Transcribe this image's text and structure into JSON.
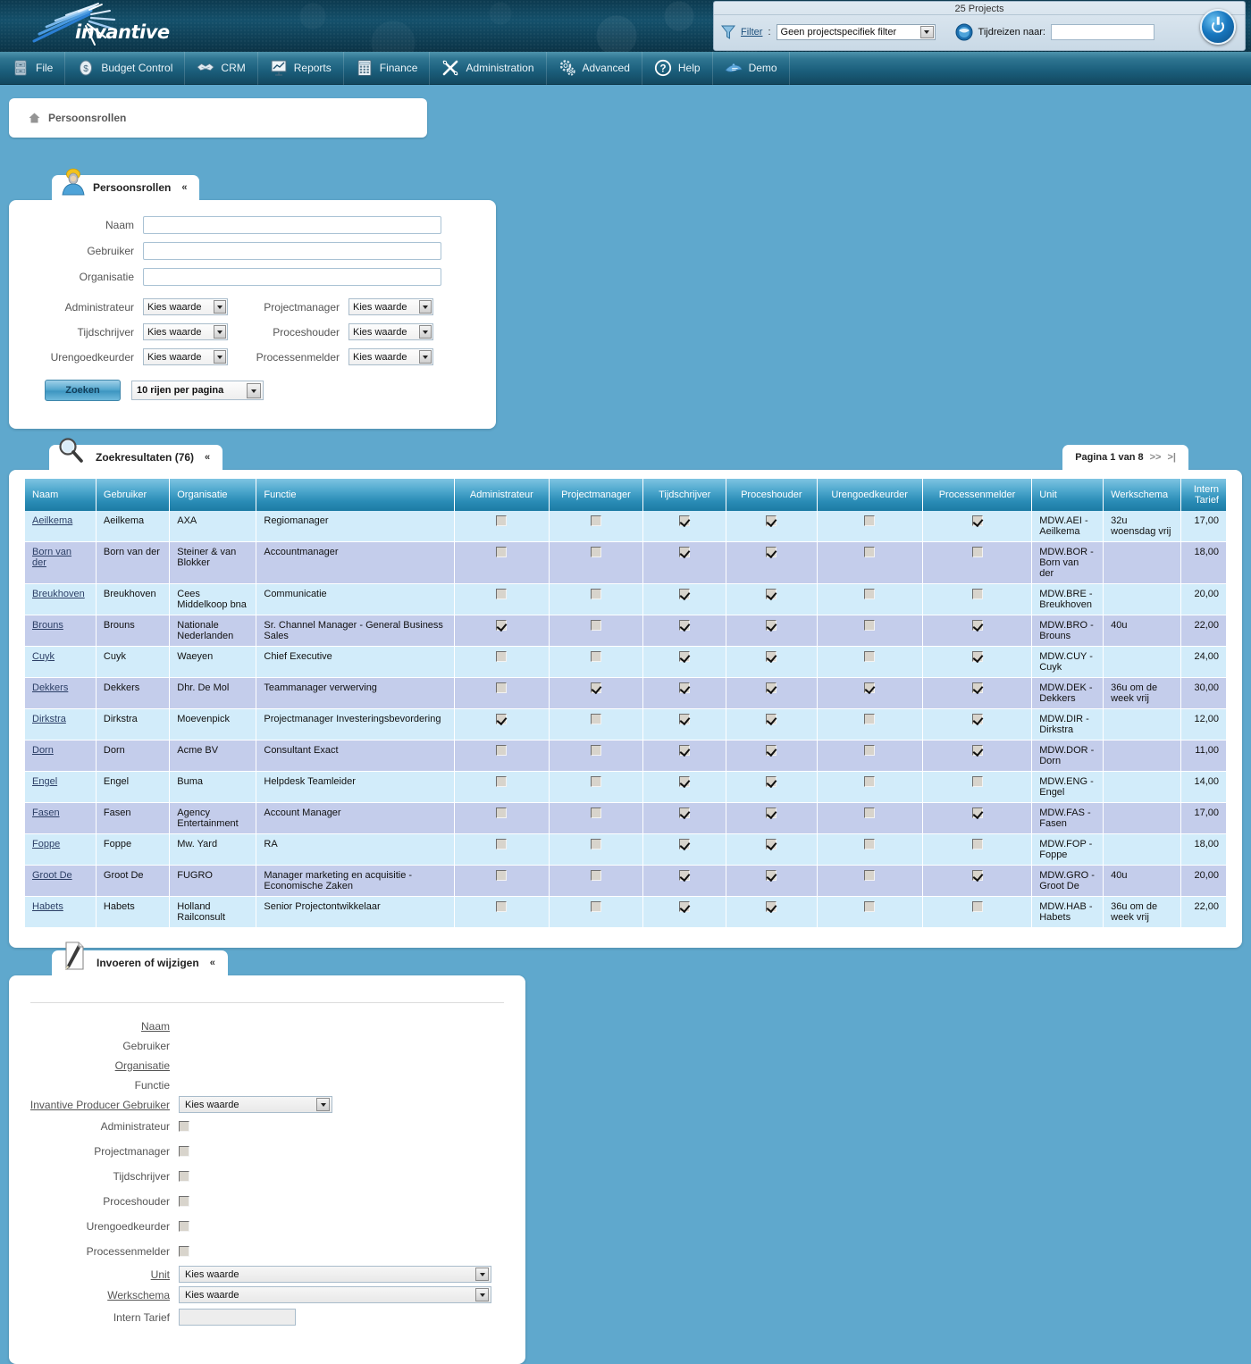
{
  "brand": {
    "logo_text": "invantive"
  },
  "topbar": {
    "projects_label": "25 Projects",
    "filter_label": "Filter",
    "colon": ":",
    "filter_value": "Geen projectspecifiek filter",
    "timetravel_label": "Tijdreizen naar:",
    "timetravel_value": "",
    "power_title": "Uitloggen"
  },
  "menu": [
    {
      "label": "File",
      "icon": "file-cabinet-icon"
    },
    {
      "label": "Budget Control",
      "icon": "money-icon"
    },
    {
      "label": "CRM",
      "icon": "handshake-icon"
    },
    {
      "label": "Reports",
      "icon": "presentation-chart-icon"
    },
    {
      "label": "Finance",
      "icon": "calculator-icon"
    },
    {
      "label": "Administration",
      "icon": "tools-icon"
    },
    {
      "label": "Advanced",
      "icon": "gears-icon"
    },
    {
      "label": "Help",
      "icon": "question-mark-icon"
    },
    {
      "label": "Demo",
      "icon": "dolphin-icon"
    }
  ],
  "breadcrumb": {
    "text": "Persoonsrollen",
    "icon": "home-icon"
  },
  "search_panel": {
    "title": "Persoonsrollen",
    "icon": "person-icon",
    "collapse_caret": "»",
    "fields": {
      "naam_label": "Naam",
      "naam_value": "",
      "gebruiker_label": "Gebruiker",
      "gebruiker_value": "",
      "organisatie_label": "Organisatie",
      "organisatie_value": "",
      "administrateur_label": "Administrateur",
      "administrateur_value": "Kies waarde",
      "projectmanager_label": "Projectmanager",
      "projectmanager_value": "Kies waarde",
      "tijdschrijver_label": "Tijdschrijver",
      "tijdschrijver_value": "Kies waarde",
      "proceshouder_label": "Proceshouder",
      "proceshouder_value": "Kies waarde",
      "urengoedkeurder_label": "Urengoedkeurder",
      "urengoedkeurder_value": "Kies waarde",
      "processenmelder_label": "Processenmelder",
      "processenmelder_value": "Kies waarde"
    },
    "search_button": "Zoeken",
    "rows_per_page": "10 rijen per pagina"
  },
  "results_panel": {
    "title": "Zoekresultaten (76)",
    "icon": "magnifier-icon",
    "collapse_caret": "»",
    "pager": {
      "text": "Pagina 1 van 8",
      "next": ">>",
      "last": ">|"
    },
    "columns": [
      "Naam",
      "Gebruiker",
      "Organisatie",
      "Functie",
      "Administrateur",
      "Projectmanager",
      "Tijdschrijver",
      "Proceshouder",
      "Urengoedkeurder",
      "Processenmelder",
      "Unit",
      "Werkschema",
      "Intern Tarief"
    ],
    "rows": [
      {
        "naam": "Aeilkema",
        "gebruiker": "Aeilkema",
        "organisatie": "AXA",
        "functie": "Regiomanager",
        "administrateur": false,
        "projectmanager": false,
        "tijdschrijver": true,
        "proceshouder": true,
        "urengoedkeurder": false,
        "processenmelder": true,
        "unit": "MDW.AEI - Aeilkema",
        "werkschema": "32u woensdag vrij",
        "tarief": "17,00"
      },
      {
        "naam": "Born van der",
        "gebruiker": "Born van der",
        "organisatie": "Steiner & van Blokker",
        "functie": "Accountmanager",
        "administrateur": false,
        "projectmanager": false,
        "tijdschrijver": true,
        "proceshouder": true,
        "urengoedkeurder": false,
        "processenmelder": false,
        "unit": "MDW.BOR - Born van der",
        "werkschema": "",
        "tarief": "18,00"
      },
      {
        "naam": "Breukhoven",
        "gebruiker": "Breukhoven",
        "organisatie": "Cees Middelkoop bna",
        "functie": "Communicatie",
        "administrateur": false,
        "projectmanager": false,
        "tijdschrijver": true,
        "proceshouder": true,
        "urengoedkeurder": false,
        "processenmelder": false,
        "unit": "MDW.BRE - Breukhoven",
        "werkschema": "",
        "tarief": "20,00"
      },
      {
        "naam": "Brouns",
        "gebruiker": "Brouns",
        "organisatie": "Nationale Nederlanden",
        "functie": "Sr. Channel Manager - General Business Sales",
        "administrateur": true,
        "projectmanager": false,
        "tijdschrijver": true,
        "proceshouder": true,
        "urengoedkeurder": false,
        "processenmelder": true,
        "unit": "MDW.BRO - Brouns",
        "werkschema": "40u",
        "tarief": "22,00"
      },
      {
        "naam": "Cuyk",
        "gebruiker": "Cuyk",
        "organisatie": "Waeyen",
        "functie": "Chief Executive",
        "administrateur": false,
        "projectmanager": false,
        "tijdschrijver": true,
        "proceshouder": true,
        "urengoedkeurder": false,
        "processenmelder": true,
        "unit": "MDW.CUY - Cuyk",
        "werkschema": "",
        "tarief": "24,00"
      },
      {
        "naam": "Dekkers",
        "gebruiker": "Dekkers",
        "organisatie": "Dhr. De Mol",
        "functie": "Teammanager verwerving",
        "administrateur": false,
        "projectmanager": true,
        "tijdschrijver": true,
        "proceshouder": true,
        "urengoedkeurder": true,
        "processenmelder": true,
        "unit": "MDW.DEK - Dekkers",
        "werkschema": "36u om de week vrij",
        "tarief": "30,00"
      },
      {
        "naam": "Dirkstra",
        "gebruiker": "Dirkstra",
        "organisatie": "Moevenpick",
        "functie": "Projectmanager Investeringsbevordering",
        "administrateur": true,
        "projectmanager": false,
        "tijdschrijver": true,
        "proceshouder": true,
        "urengoedkeurder": false,
        "processenmelder": true,
        "unit": "MDW.DIR - Dirkstra",
        "werkschema": "",
        "tarief": "12,00"
      },
      {
        "naam": "Dorn",
        "gebruiker": "Dorn",
        "organisatie": "Acme BV",
        "functie": "Consultant Exact",
        "administrateur": false,
        "projectmanager": false,
        "tijdschrijver": true,
        "proceshouder": true,
        "urengoedkeurder": false,
        "processenmelder": true,
        "unit": "MDW.DOR - Dorn",
        "werkschema": "",
        "tarief": "11,00"
      },
      {
        "naam": "Engel",
        "gebruiker": "Engel",
        "organisatie": "Buma",
        "functie": "Helpdesk Teamleider",
        "administrateur": false,
        "projectmanager": false,
        "tijdschrijver": true,
        "proceshouder": true,
        "urengoedkeurder": false,
        "processenmelder": false,
        "unit": "MDW.ENG - Engel",
        "werkschema": "",
        "tarief": "14,00"
      },
      {
        "naam": "Fasen",
        "gebruiker": "Fasen",
        "organisatie": "Agency Entertainment",
        "functie": "Account Manager",
        "administrateur": false,
        "projectmanager": false,
        "tijdschrijver": true,
        "proceshouder": true,
        "urengoedkeurder": false,
        "processenmelder": true,
        "unit": "MDW.FAS - Fasen",
        "werkschema": "",
        "tarief": "17,00"
      },
      {
        "naam": "Foppe",
        "gebruiker": "Foppe",
        "organisatie": "Mw. Yard",
        "functie": "RA",
        "administrateur": false,
        "projectmanager": false,
        "tijdschrijver": true,
        "proceshouder": true,
        "urengoedkeurder": false,
        "processenmelder": false,
        "unit": "MDW.FOP - Foppe",
        "werkschema": "",
        "tarief": "18,00"
      },
      {
        "naam": "Groot De",
        "gebruiker": "Groot De",
        "organisatie": "FUGRO",
        "functie": "Manager marketing en acquisitie - Economische Zaken",
        "administrateur": false,
        "projectmanager": false,
        "tijdschrijver": true,
        "proceshouder": true,
        "urengoedkeurder": false,
        "processenmelder": true,
        "unit": "MDW.GRO - Groot De",
        "werkschema": "40u",
        "tarief": "20,00"
      },
      {
        "naam": "Habets",
        "gebruiker": "Habets",
        "organisatie": "Holland Railconsult",
        "functie": "Senior Projectontwikkelaar",
        "administrateur": false,
        "projectmanager": false,
        "tijdschrijver": true,
        "proceshouder": true,
        "urengoedkeurder": false,
        "processenmelder": false,
        "unit": "MDW.HAB - Habets",
        "werkschema": "36u om de week vrij",
        "tarief": "22,00"
      }
    ]
  },
  "edit_panel": {
    "title": "Invoeren of wijzigen",
    "icon": "pencil-document-icon",
    "collapse_caret": "»",
    "fields": {
      "naam_label": "Naam",
      "gebruiker_label": "Gebruiker",
      "organisatie_label": "Organisatie",
      "functie_label": "Functie",
      "producer_label": "Invantive Producer Gebruiker",
      "producer_value": "Kies waarde",
      "administrateur_label": "Administrateur",
      "projectmanager_label": "Projectmanager",
      "tijdschrijver_label": "Tijdschrijver",
      "proceshouder_label": "Proceshouder",
      "urengoedkeurder_label": "Urengoedkeurder",
      "processenmelder_label": "Processenmelder",
      "unit_label": "Unit",
      "unit_value": "Kies waarde",
      "werkschema_label": "Werkschema",
      "werkschema_value": "Kies waarde",
      "tarief_label": "Intern Tarief",
      "tarief_value": ""
    }
  },
  "colors": {
    "page_bg": "#5fa8cd",
    "header_dark": "#0d3a4f",
    "menu_teal": "#1b5e7b",
    "grid_header": "#2a8cb6",
    "row_odd": "#d2ecfa",
    "row_even": "#c4cdeb",
    "link": "#2c3f66"
  }
}
